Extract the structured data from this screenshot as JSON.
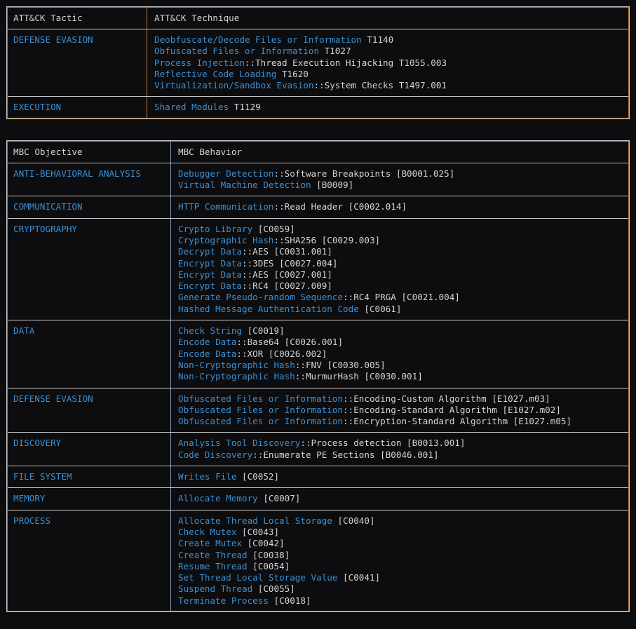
{
  "colors": {
    "background": "#0d0d0f",
    "blue_text": "#3b8fd4",
    "plain_text": "#d4d4d4",
    "border_outer": "#c8c8c8",
    "border_vertical_attack": "#b5773a",
    "border_vertical_mbc": "#7d96b8"
  },
  "attack_table": {
    "headers": {
      "tactic": "ATT&CK Tactic",
      "technique": "ATT&CK Technique"
    },
    "rows": [
      {
        "tactic": "DEFENSE EVASION",
        "techniques": [
          {
            "blue": "Deobfuscate/Decode Files or Information",
            "plain": " T1140"
          },
          {
            "blue": "Obfuscated Files or Information",
            "plain": " T1027"
          },
          {
            "blue": "Process Injection",
            "plain": "::Thread Execution Hijacking T1055.003"
          },
          {
            "blue": "Reflective Code Loading",
            "plain": " T1620"
          },
          {
            "blue": "Virtualization/Sandbox Evasion",
            "plain": "::System Checks T1497.001"
          }
        ]
      },
      {
        "tactic": "EXECUTION",
        "techniques": [
          {
            "blue": "Shared Modules",
            "plain": " T1129"
          }
        ]
      }
    ]
  },
  "mbc_table": {
    "headers": {
      "objective": "MBC Objective",
      "behavior": "MBC Behavior"
    },
    "rows": [
      {
        "objective": "ANTI-BEHAVIORAL ANALYSIS",
        "behaviors": [
          {
            "blue": "Debugger Detection",
            "plain": "::Software Breakpoints [B0001.025]"
          },
          {
            "blue": "Virtual Machine Detection",
            "plain": " [B0009]"
          }
        ]
      },
      {
        "objective": "COMMUNICATION",
        "behaviors": [
          {
            "blue": "HTTP Communication",
            "plain": "::Read Header [C0002.014]"
          }
        ]
      },
      {
        "objective": "CRYPTOGRAPHY",
        "behaviors": [
          {
            "blue": "Crypto Library",
            "plain": " [C0059]"
          },
          {
            "blue": "Cryptographic Hash",
            "plain": "::SHA256 [C0029.003]"
          },
          {
            "blue": "Decrypt Data",
            "plain": "::AES [C0031.001]"
          },
          {
            "blue": "Encrypt Data",
            "plain": "::3DES [C0027.004]"
          },
          {
            "blue": "Encrypt Data",
            "plain": "::AES [C0027.001]"
          },
          {
            "blue": "Encrypt Data",
            "plain": "::RC4 [C0027.009]"
          },
          {
            "blue": "Generate Pseudo-random Sequence",
            "plain": "::RC4 PRGA [C0021.004]"
          },
          {
            "blue": "Hashed Message Authentication Code",
            "plain": " [C0061]"
          }
        ]
      },
      {
        "objective": "DATA",
        "behaviors": [
          {
            "blue": "Check String",
            "plain": " [C0019]"
          },
          {
            "blue": "Encode Data",
            "plain": "::Base64 [C0026.001]"
          },
          {
            "blue": "Encode Data",
            "plain": "::XOR [C0026.002]"
          },
          {
            "blue": "Non-Cryptographic Hash",
            "plain": "::FNV [C0030.005]"
          },
          {
            "blue": "Non-Cryptographic Hash",
            "plain": "::MurmurHash [C0030.001]"
          }
        ]
      },
      {
        "objective": "DEFENSE EVASION",
        "behaviors": [
          {
            "blue": "Obfuscated Files or Information",
            "plain": "::Encoding-Custom Algorithm [E1027.m03]"
          },
          {
            "blue": "Obfuscated Files or Information",
            "plain": "::Encoding-Standard Algorithm [E1027.m02]"
          },
          {
            "blue": "Obfuscated Files or Information",
            "plain": "::Encryption-Standard Algorithm [E1027.m05]"
          }
        ]
      },
      {
        "objective": "DISCOVERY",
        "behaviors": [
          {
            "blue": "Analysis Tool Discovery",
            "plain": "::Process detection [B0013.001]"
          },
          {
            "blue": "Code Discovery",
            "plain": "::Enumerate PE Sections [B0046.001]"
          }
        ]
      },
      {
        "objective": "FILE SYSTEM",
        "behaviors": [
          {
            "blue": "Writes File",
            "plain": " [C0052]"
          }
        ]
      },
      {
        "objective": "MEMORY",
        "behaviors": [
          {
            "blue": "Allocate Memory",
            "plain": " [C0007]"
          }
        ]
      },
      {
        "objective": "PROCESS",
        "behaviors": [
          {
            "blue": "Allocate Thread Local Storage",
            "plain": " [C0040]"
          },
          {
            "blue": "Check Mutex",
            "plain": " [C0043]"
          },
          {
            "blue": "Create Mutex",
            "plain": " [C0042]"
          },
          {
            "blue": "Create Thread",
            "plain": " [C0038]"
          },
          {
            "blue": "Resume Thread",
            "plain": " [C0054]"
          },
          {
            "blue": "Set Thread Local Storage Value",
            "plain": " [C0041]"
          },
          {
            "blue": "Suspend Thread",
            "plain": " [C0055]"
          },
          {
            "blue": "Terminate Process",
            "plain": " [C0018]"
          }
        ]
      }
    ]
  }
}
